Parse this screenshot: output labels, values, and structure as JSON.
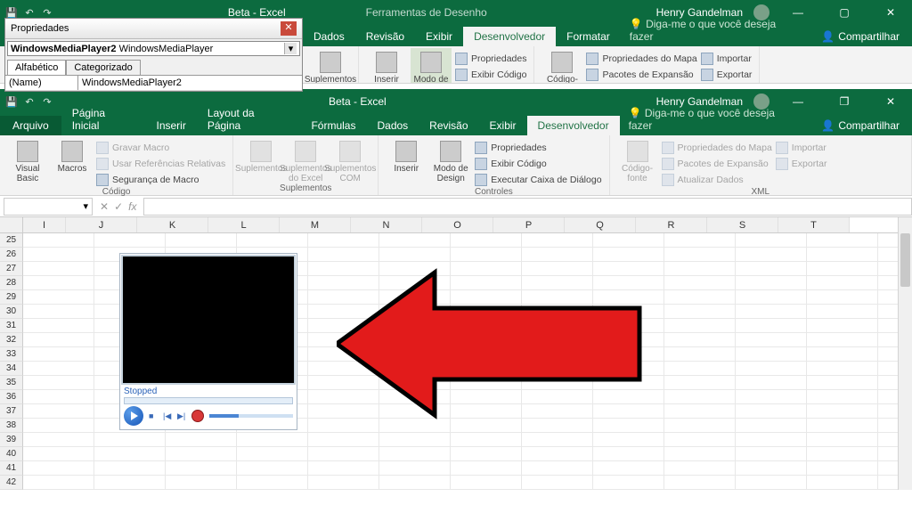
{
  "top": {
    "title_doc": "Beta",
    "title_app": "Excel",
    "context_tab": "Ferramentas de Desenho",
    "user": "Henry Gandelman",
    "tabs_partial": [
      "Dados",
      "Revisão",
      "Exibir",
      "Desenvolvedor",
      "Formatar"
    ],
    "tellme": "Diga-me o que você deseja fazer",
    "share": "Compartilhar",
    "rbn": {
      "suplementos": {
        "btn": "Suplementos"
      },
      "controles": {
        "insert": "Inserir",
        "mode": "Modo de",
        "props": "Propriedades",
        "code": "Exibir Código"
      },
      "xml": {
        "source": "Código-",
        "mapprops": "Propriedades do Mapa",
        "expansion": "Pacotes de Expansão",
        "import": "Importar",
        "export": "Exportar"
      }
    }
  },
  "props": {
    "title": "Propriedades",
    "combo_bold": "WindowsMediaPlayer2",
    "combo_rest": "WindowsMediaPlayer",
    "tab_alpha": "Alfabético",
    "tab_cat": "Categorizado",
    "row_name_key": "(Name)",
    "row_name_val": "WindowsMediaPlayer2"
  },
  "main": {
    "title_doc": "Beta",
    "title_app": "Excel",
    "user": "Henry Gandelman",
    "file": "Arquivo",
    "tabs": [
      "Página Inicial",
      "Inserir",
      "Layout da Página",
      "Fórmulas",
      "Dados",
      "Revisão",
      "Exibir",
      "Desenvolvedor"
    ],
    "active_tab": "Desenvolvedor",
    "tellme": "Diga-me o que você deseja fazer",
    "share": "Compartilhar",
    "grp": {
      "codigo": {
        "label": "Código",
        "vb": "Visual Basic",
        "macros": "Macros",
        "record": "Gravar Macro",
        "relref": "Usar Referências Relativas",
        "security": "Segurança de Macro"
      },
      "supl": {
        "label": "Suplementos",
        "a": "Suplementos",
        "b": "Suplementos do Excel",
        "c": "Suplementos COM"
      },
      "ctl": {
        "label": "Controles",
        "insert": "Inserir",
        "mode": "Modo de Design",
        "props": "Propriedades",
        "code": "Exibir Código",
        "dialog": "Executar Caixa de Diálogo"
      },
      "xml": {
        "label": "XML",
        "source": "Código-fonte",
        "mapprops": "Propriedades do Mapa",
        "expansion": "Pacotes de Expansão",
        "refresh": "Atualizar Dados",
        "import": "Importar",
        "export": "Exportar"
      }
    },
    "cols": [
      "I",
      "J",
      "K",
      "L",
      "M",
      "N",
      "O",
      "P",
      "Q",
      "R",
      "S",
      "T"
    ],
    "rows_start": 25,
    "rows_end": 42,
    "wmp_status": "Stopped"
  }
}
